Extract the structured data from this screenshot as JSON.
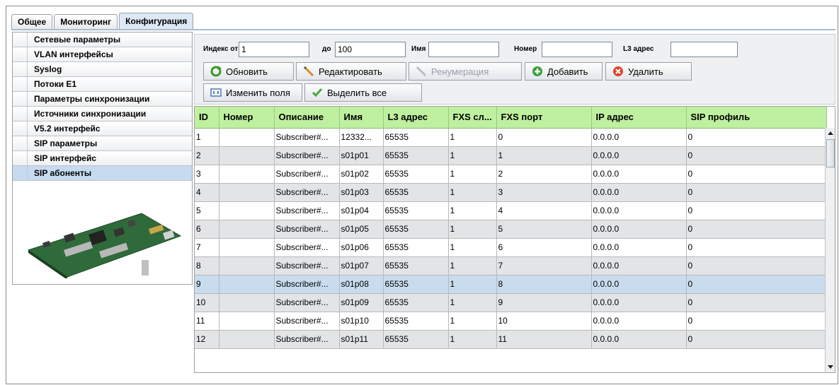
{
  "tabs": [
    "Общее",
    "Мониторинг",
    "Конфигурация"
  ],
  "sidebar": {
    "items": [
      "Сетевые параметры",
      "VLAN интерфейсы",
      "Syslog",
      "Потоки E1",
      "Параметры синхронизации",
      "Источники синхронизации",
      "V5.2 интерфейс",
      "SIP параметры",
      "SIP интерфейс",
      "SIP абоненты"
    ]
  },
  "filter": {
    "index_from_label": "Индекс от",
    "index_from_value": "1",
    "index_to_label": "до",
    "index_to_value": "100",
    "name_label": "Имя",
    "name_value": "",
    "number_label": "Номер",
    "number_value": "",
    "l3_label": "L3 адрес",
    "l3_value": ""
  },
  "toolbar": {
    "refresh": "Обновить",
    "edit": "Редактировать",
    "renumber": "Ренумерация",
    "add": "Добавить",
    "delete": "Удалить",
    "change_fields": "Изменить поля",
    "select_all": "Выделить все"
  },
  "table": {
    "headers": [
      "ID",
      "Номер",
      "Описание",
      "Имя",
      "L3 адрес",
      "FXS сл...",
      "FXS порт",
      "IP адрес",
      "SIP профиль"
    ],
    "rows": [
      [
        "1",
        "",
        "Subscriber#...",
        "12332...",
        "65535",
        "1",
        "0",
        "0.0.0.0",
        "0"
      ],
      [
        "2",
        "",
        "Subscriber#...",
        "s01p01",
        "65535",
        "1",
        "1",
        "0.0.0.0",
        "0"
      ],
      [
        "3",
        "",
        "Subscriber#...",
        "s01p02",
        "65535",
        "1",
        "2",
        "0.0.0.0",
        "0"
      ],
      [
        "4",
        "",
        "Subscriber#...",
        "s01p03",
        "65535",
        "1",
        "3",
        "0.0.0.0",
        "0"
      ],
      [
        "5",
        "",
        "Subscriber#...",
        "s01p04",
        "65535",
        "1",
        "4",
        "0.0.0.0",
        "0"
      ],
      [
        "6",
        "",
        "Subscriber#...",
        "s01p05",
        "65535",
        "1",
        "5",
        "0.0.0.0",
        "0"
      ],
      [
        "7",
        "",
        "Subscriber#...",
        "s01p06",
        "65535",
        "1",
        "6",
        "0.0.0.0",
        "0"
      ],
      [
        "8",
        "",
        "Subscriber#...",
        "s01p07",
        "65535",
        "1",
        "7",
        "0.0.0.0",
        "0"
      ],
      [
        "9",
        "",
        "Subscriber#...",
        "s01p08",
        "65535",
        "1",
        "8",
        "0.0.0.0",
        "0"
      ],
      [
        "10",
        "",
        "Subscriber#...",
        "s01p09",
        "65535",
        "1",
        "9",
        "0.0.0.0",
        "0"
      ],
      [
        "11",
        "",
        "Subscriber#...",
        "s01p10",
        "65535",
        "1",
        "10",
        "0.0.0.0",
        "0"
      ],
      [
        "12",
        "",
        "Subscriber#...",
        "s01p11",
        "65535",
        "1",
        "11",
        "0.0.0.0",
        "0"
      ]
    ]
  },
  "colors": {
    "header_bg": "#bff0a0",
    "selected_row": "#c8dcee",
    "active_sidebar": "#c6daf0"
  }
}
